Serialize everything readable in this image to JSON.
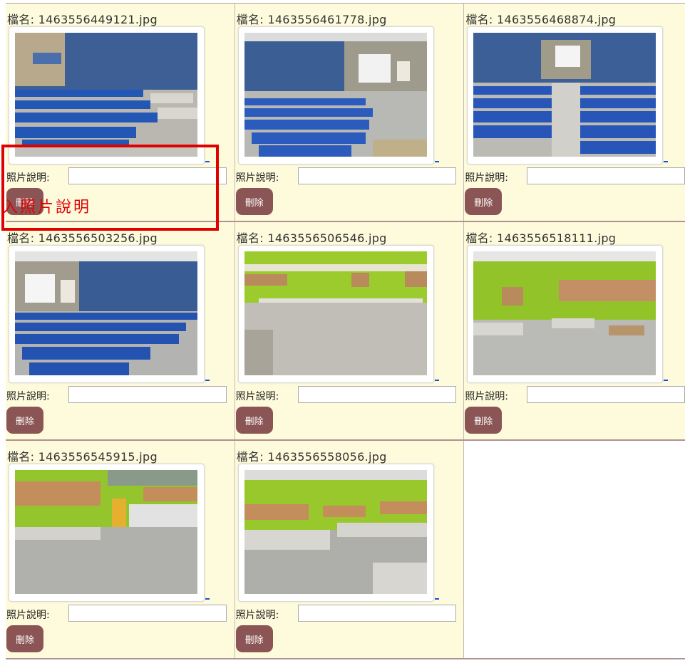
{
  "labels": {
    "filename_prefix": "檔名: ",
    "description_label": "照片說明:",
    "delete_button": "刪除"
  },
  "photos": [
    {
      "filename": "檔名: 1463556449121.jpg",
      "description": "",
      "scene": "seats-left"
    },
    {
      "filename": "檔名: 1463556461778.jpg",
      "description": "",
      "scene": "seats-screen"
    },
    {
      "filename": "檔名: 1463556468874.jpg",
      "description": "",
      "scene": "seats-aisle"
    },
    {
      "filename": "檔名: 1463556503256.jpg",
      "description": "",
      "scene": "seats-back"
    },
    {
      "filename": "檔名: 1463556506546.jpg",
      "description": "",
      "scene": "green-room"
    },
    {
      "filename": "檔名: 1463556518111.jpg",
      "description": "",
      "scene": "green-room-corner"
    },
    {
      "filename": "檔名: 1463556545915.jpg",
      "description": "",
      "scene": "green-room-door"
    },
    {
      "filename": "檔名: 1463556558056.jpg",
      "description": "",
      "scene": "green-room-tables"
    }
  ],
  "annotation": {
    "text": "輸入照片說明",
    "color": "#e00000"
  },
  "colors": {
    "cell_background": "#fefbdc",
    "button_background": "#8b5555",
    "wall_blue": "#3a5d94",
    "wall_green": "#9acd32"
  }
}
